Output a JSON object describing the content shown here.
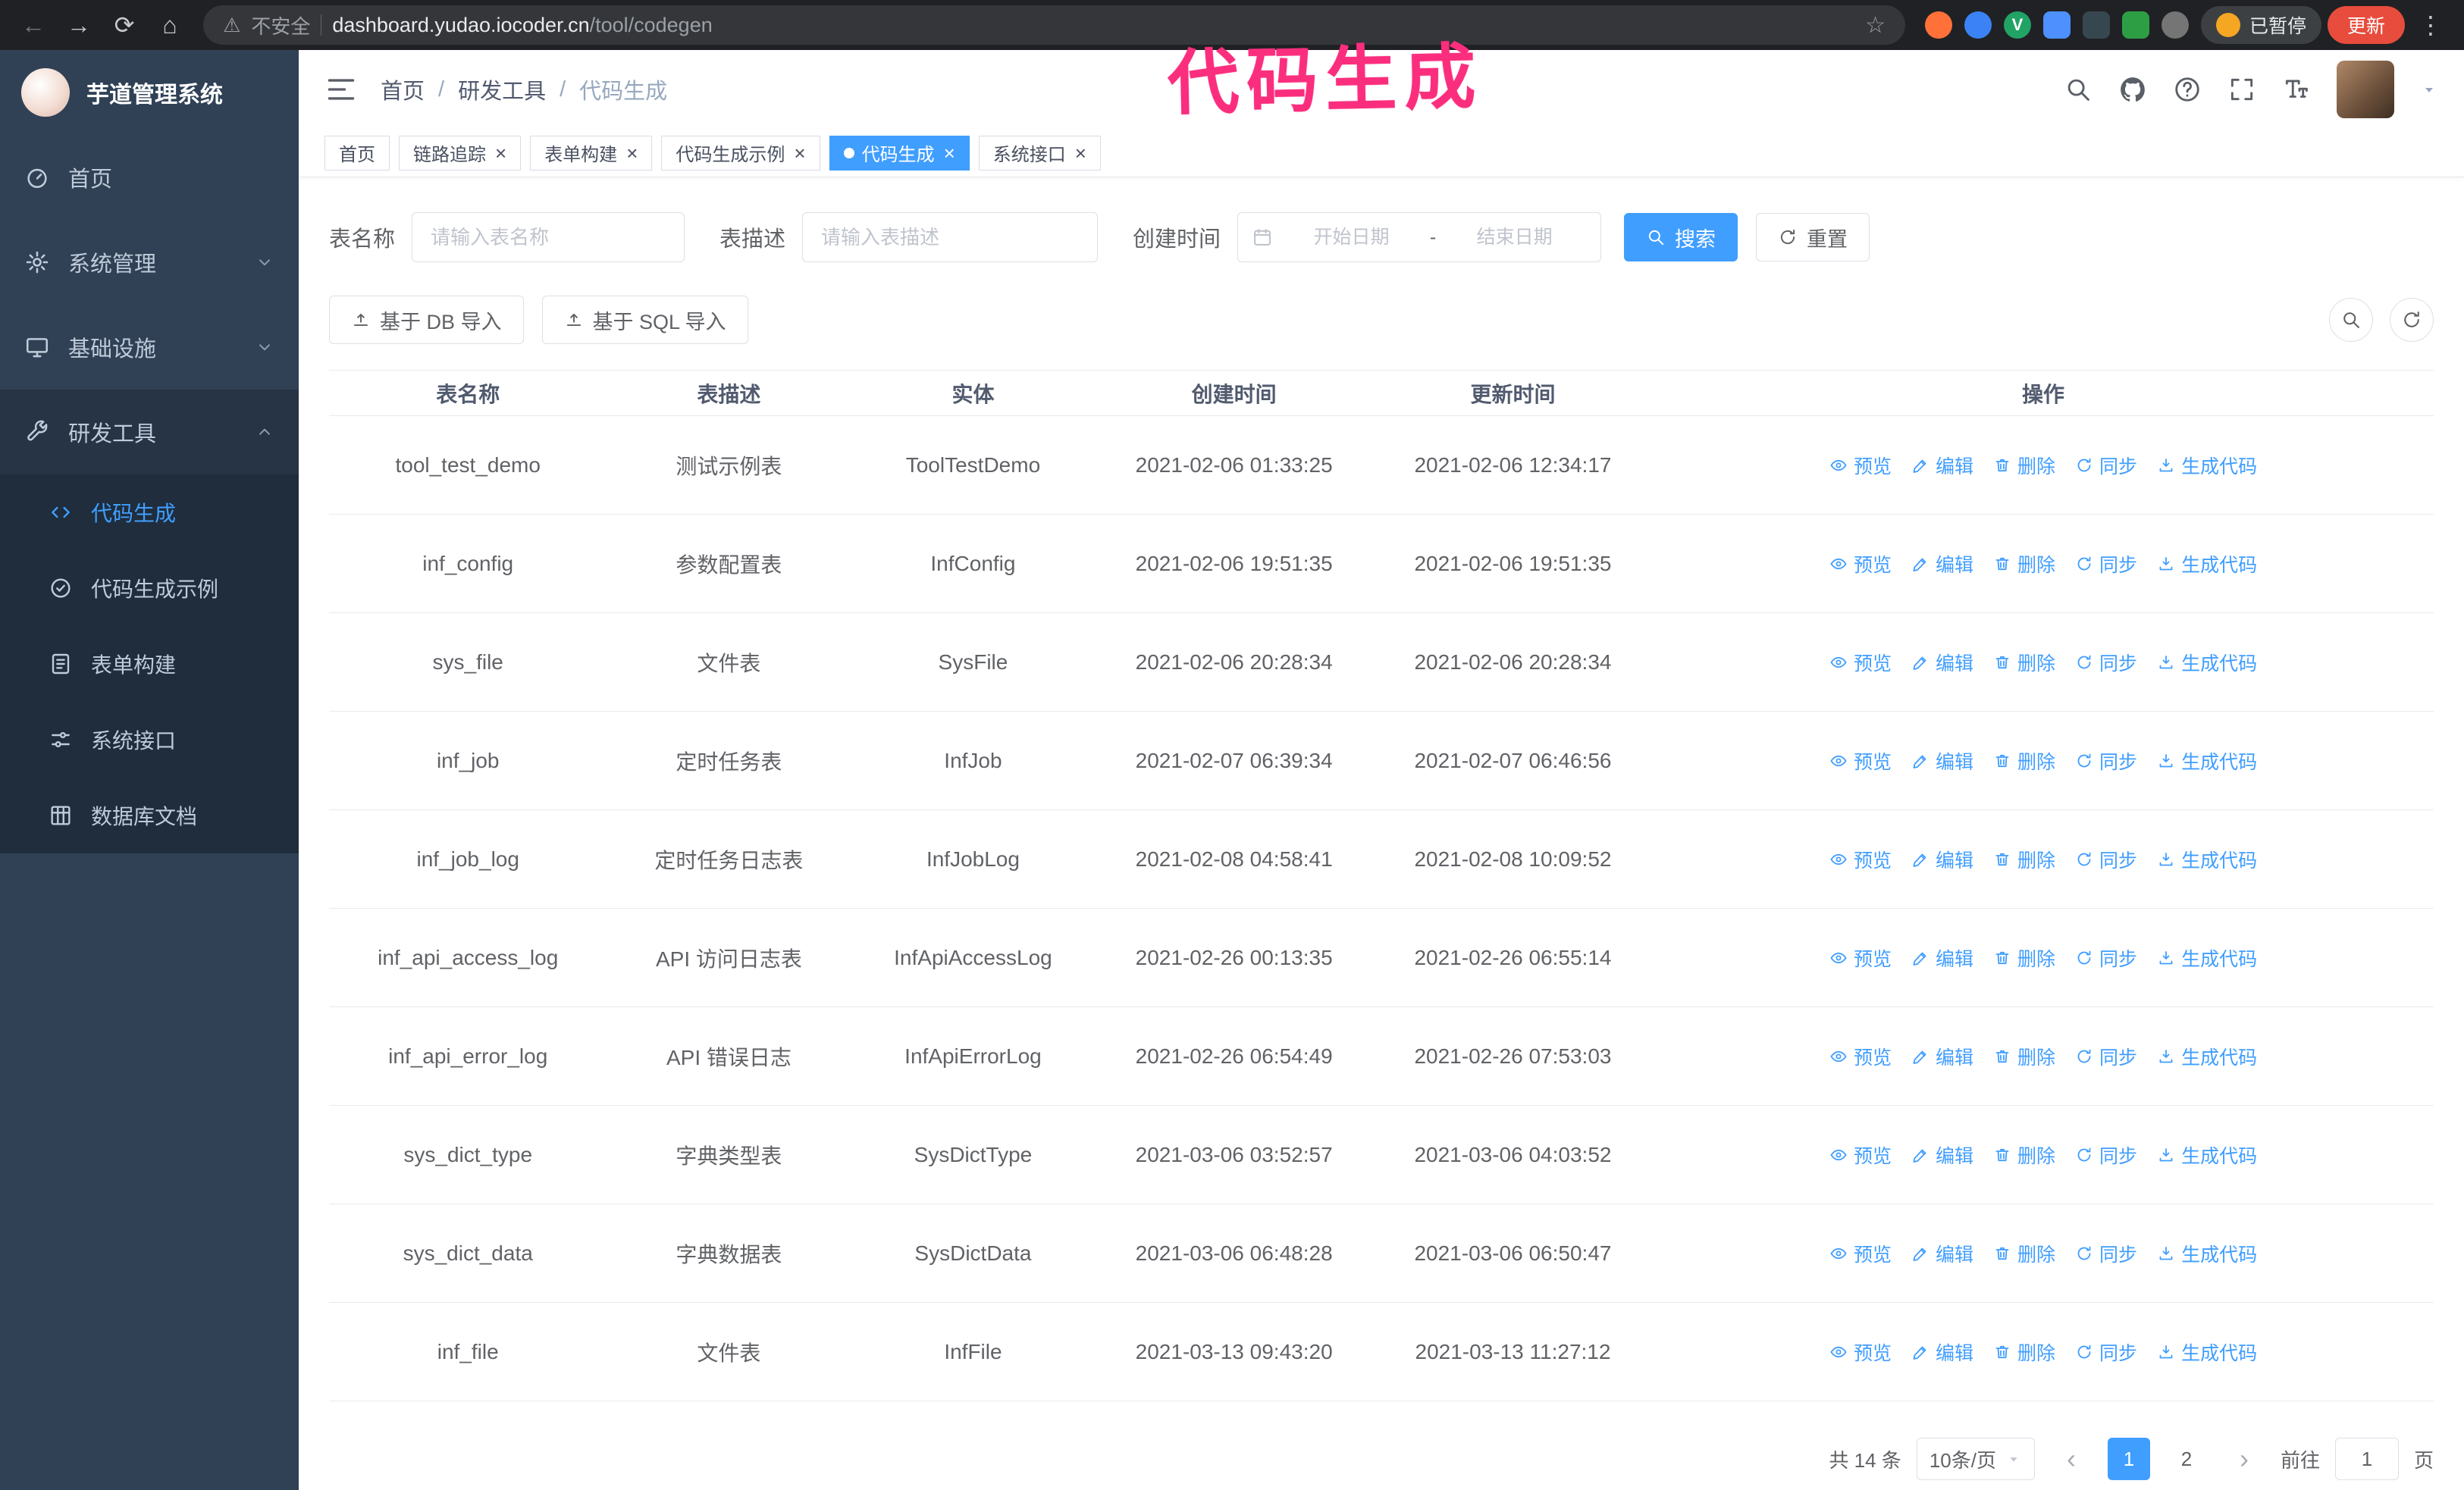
{
  "colors": {
    "accent": "#409eff",
    "sidebar_bg": "#304156",
    "submenu_bg": "#1f2d3d",
    "chrome_bg": "#202124",
    "annotation": "#fb2e7e",
    "update_btn": "#e74c3c",
    "pill_face": "#f5a623"
  },
  "annotation": {
    "text": "代码生成"
  },
  "browser": {
    "security_label": "不安全",
    "url_domain": "dashboard.yudao.iocoder.cn",
    "url_path": "/tool/codegen",
    "paused_badge": "已暂停",
    "update_button": "更新",
    "extensions": [
      {
        "color": "#ff7139",
        "shape": "circle",
        "letter": ""
      },
      {
        "color": "#3b82f6",
        "shape": "circle",
        "letter": ""
      },
      {
        "color": "#21a366",
        "shape": "circle",
        "letter": "V"
      },
      {
        "color": "#4d90fe",
        "shape": "square",
        "letter": ""
      },
      {
        "color": "#37474f",
        "shape": "square",
        "letter": ""
      },
      {
        "color": "#2e9e44",
        "shape": "square",
        "letter": ""
      },
      {
        "color": "#757575",
        "shape": "circle",
        "letter": ""
      }
    ]
  },
  "sidebar": {
    "logo_title": "芋道管理系统",
    "items": [
      {
        "key": "home",
        "label": "首页",
        "icon": "dashboard",
        "type": "item"
      },
      {
        "key": "system",
        "label": "系统管理",
        "icon": "gear",
        "type": "group"
      },
      {
        "key": "infra",
        "label": "基础设施",
        "icon": "infra",
        "type": "group"
      },
      {
        "key": "devtools",
        "label": "研发工具",
        "icon": "tools",
        "type": "group",
        "children": [
          {
            "key": "codegen",
            "label": "代码生成",
            "icon": "code",
            "active": true
          },
          {
            "key": "codegen-example",
            "label": "代码生成示例",
            "icon": "example"
          },
          {
            "key": "form-build",
            "label": "表单构建",
            "icon": "form"
          },
          {
            "key": "system-api",
            "label": "系统接口",
            "icon": "api"
          },
          {
            "key": "db-doc",
            "label": "数据库文档",
            "icon": "db"
          }
        ]
      }
    ]
  },
  "header": {
    "breadcrumb": [
      "首页",
      "研发工具",
      "代码生成"
    ],
    "separator": "/"
  },
  "tabs": [
    {
      "key": "home",
      "label": "首页",
      "closable": false,
      "active": false
    },
    {
      "key": "trace",
      "label": "链路追踪",
      "closable": true,
      "active": false
    },
    {
      "key": "form-build",
      "label": "表单构建",
      "closable": true,
      "active": false
    },
    {
      "key": "codegen-example",
      "label": "代码生成示例",
      "closable": true,
      "active": false
    },
    {
      "key": "codegen",
      "label": "代码生成",
      "closable": true,
      "active": true
    },
    {
      "key": "system-api",
      "label": "系统接口",
      "closable": true,
      "active": false
    }
  ],
  "filters": {
    "table_name_label": "表名称",
    "table_name_placeholder": "请输入表名称",
    "table_desc_label": "表描述",
    "table_desc_placeholder": "请输入表描述",
    "create_time_label": "创建时间",
    "date_start_placeholder": "开始日期",
    "date_separator": "-",
    "date_end_placeholder": "结束日期",
    "search_button": "搜索",
    "reset_button": "重置"
  },
  "toolbar": {
    "import_db": "基于 DB 导入",
    "import_sql": "基于 SQL 导入"
  },
  "table": {
    "columns": [
      "表名称",
      "表描述",
      "实体",
      "创建时间",
      "更新时间",
      "操作"
    ],
    "actions": [
      {
        "key": "preview",
        "label": "预览",
        "icon": "eye"
      },
      {
        "key": "edit",
        "label": "编辑",
        "icon": "edit"
      },
      {
        "key": "delete",
        "label": "删除",
        "icon": "trash"
      },
      {
        "key": "sync",
        "label": "同步",
        "icon": "sync"
      },
      {
        "key": "generate",
        "label": "生成代码",
        "icon": "download"
      }
    ],
    "rows": [
      {
        "name": "tool_test_demo",
        "desc": "测试示例表",
        "entity": "ToolTestDemo",
        "created": "2021-02-06 01:33:25",
        "updated": "2021-02-06 12:34:17"
      },
      {
        "name": "inf_config",
        "desc": "参数配置表",
        "entity": "InfConfig",
        "created": "2021-02-06 19:51:35",
        "updated": "2021-02-06 19:51:35"
      },
      {
        "name": "sys_file",
        "desc": "文件表",
        "entity": "SysFile",
        "created": "2021-02-06 20:28:34",
        "updated": "2021-02-06 20:28:34"
      },
      {
        "name": "inf_job",
        "desc": "定时任务表",
        "entity": "InfJob",
        "created": "2021-02-07 06:39:34",
        "updated": "2021-02-07 06:46:56"
      },
      {
        "name": "inf_job_log",
        "desc": "定时任务日志表",
        "entity": "InfJobLog",
        "created": "2021-02-08 04:58:41",
        "updated": "2021-02-08 10:09:52"
      },
      {
        "name": "inf_api_access_log",
        "desc": "API 访问日志表",
        "entity": "InfApiAccessLog",
        "created": "2021-02-26 00:13:35",
        "updated": "2021-02-26 06:55:14"
      },
      {
        "name": "inf_api_error_log",
        "desc": "API 错误日志",
        "entity": "InfApiErrorLog",
        "created": "2021-02-26 06:54:49",
        "updated": "2021-02-26 07:53:03"
      },
      {
        "name": "sys_dict_type",
        "desc": "字典类型表",
        "entity": "SysDictType",
        "created": "2021-03-06 03:52:57",
        "updated": "2021-03-06 04:03:52"
      },
      {
        "name": "sys_dict_data",
        "desc": "字典数据表",
        "entity": "SysDictData",
        "created": "2021-03-06 06:48:28",
        "updated": "2021-03-06 06:50:47"
      },
      {
        "name": "inf_file",
        "desc": "文件表",
        "entity": "InfFile",
        "created": "2021-03-13 09:43:20",
        "updated": "2021-03-13 11:27:12"
      }
    ]
  },
  "pagination": {
    "total_text": "共 14 条",
    "page_size": "10条/页",
    "pages": [
      "1",
      "2"
    ],
    "active_page": "1",
    "goto_label": "前往",
    "goto_value": "1",
    "goto_suffix": "页"
  }
}
